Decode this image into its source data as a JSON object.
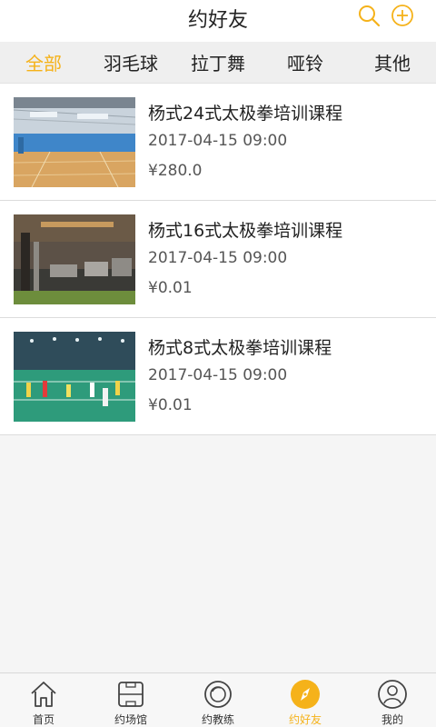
{
  "header": {
    "title": "约好友",
    "search_icon": "search-icon",
    "add_icon": "plus-circle-icon",
    "accent_color": "#f5b21a"
  },
  "tabs": [
    {
      "label": "全部",
      "active": true
    },
    {
      "label": "羽毛球",
      "active": false
    },
    {
      "label": "拉丁舞",
      "active": false
    },
    {
      "label": "哑铃",
      "active": false
    },
    {
      "label": "其他",
      "active": false
    }
  ],
  "courses": [
    {
      "name": "杨式24式太极拳培训课程",
      "time": "2017-04-15 09:00",
      "price": "¥280.0",
      "image": "gym-hall-photo"
    },
    {
      "name": "杨式16式太极拳培训课程",
      "time": "2017-04-15 09:00",
      "price": "¥0.01",
      "image": "fitness-room-photo"
    },
    {
      "name": "杨式8式太极拳培训课程",
      "time": "2017-04-15 09:00",
      "price": "¥0.01",
      "image": "badminton-court-photo"
    }
  ],
  "bottom_nav": [
    {
      "label": "首页",
      "icon": "home-icon",
      "active": false
    },
    {
      "label": "约场馆",
      "icon": "venue-icon",
      "active": false
    },
    {
      "label": "约教练",
      "icon": "coach-icon",
      "active": false
    },
    {
      "label": "约好友",
      "icon": "compass-icon",
      "active": true
    },
    {
      "label": "我的",
      "icon": "profile-icon",
      "active": false
    }
  ]
}
